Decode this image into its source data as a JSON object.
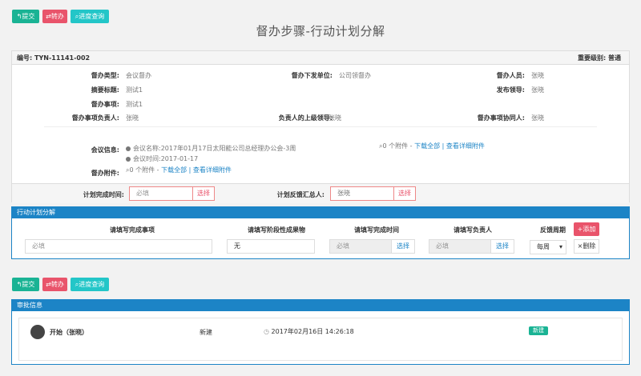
{
  "toolbar": {
    "submit": "提交",
    "transfer": "转办",
    "progress": "进度查询"
  },
  "page_title": "督办步骤-行动计划分解",
  "info": {
    "id_label": "编号:",
    "id_value": "TYN-11141-002",
    "importance_label": "重要级别:",
    "importance_value": "普通",
    "fields": {
      "supervise_type_label": "督办类型:",
      "supervise_type_value": "会议督办",
      "issuing_unit_label": "督办下发单位:",
      "issuing_unit_value": "公司领督办",
      "supervisor_label": "督办人员:",
      "supervisor_value": "张晓",
      "summary_title_label": "摘要标题:",
      "summary_title_value": "测试1",
      "publisher_label": "发布领导:",
      "publisher_value": "张晓",
      "matter_label": "督办事项:",
      "matter_value": "测试1",
      "responsible_label": "督办事项负责人:",
      "responsible_value": "张晓",
      "superior_label": "负责人的上级领导:",
      "superior_value": "张晓",
      "assistant_label": "督办事项协同人:",
      "assistant_value": "张晓"
    },
    "meeting": {
      "label": "会议信息:",
      "name_prefix": "会议名称:",
      "name_value": "2017年01月17日太阳能公司总经理办公会-3周",
      "time_prefix": "会议时间:",
      "time_value": "2017-01-17",
      "attach_count": "0 个附件 -",
      "download_all": "下载全部",
      "sep": "|",
      "view_detail": "查看详细附件"
    },
    "attachments": {
      "label": "督办附件:",
      "count": "0 个附件 -",
      "download_all": "下载全部",
      "sep": "|",
      "view_detail": "查看详细附件"
    }
  },
  "plan_row": {
    "complete_time_label": "计划完成时间:",
    "complete_time_placeholder": "必填",
    "select": "选择",
    "feedback_label": "计划反馈汇总人:",
    "feedback_value": "张晓"
  },
  "action_plan": {
    "title": "行动计划分解",
    "headers": [
      "请填写完成事项",
      "请填写阶段性成果物",
      "请填写完成时间",
      "请填写负责人",
      "反馈周期"
    ],
    "row": {
      "item_placeholder": "必填",
      "result_value": "无",
      "time_placeholder": "必填",
      "owner_placeholder": "必填",
      "select": "选择",
      "cycle_value": "每周"
    },
    "add": "添加",
    "delete": "删除"
  },
  "approval": {
    "title": "审批信息",
    "step": "开始（张晓）",
    "status": "新建",
    "time": "2017年02月16日 14:26:18",
    "badge": "新建"
  },
  "colors": {
    "primary": "#1ab394",
    "danger": "#e9546b",
    "info": "#23c6c8",
    "blue": "#1c84c6"
  }
}
